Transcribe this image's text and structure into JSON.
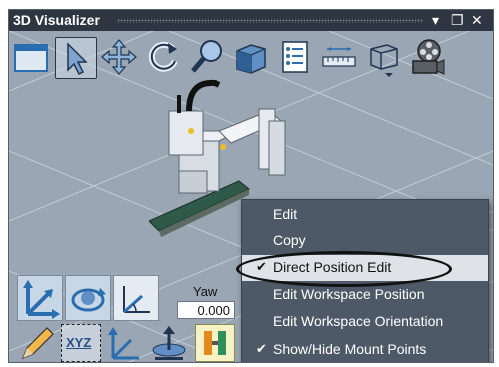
{
  "window": {
    "title": "3D Visualizer",
    "pin_glyph": "▾",
    "maximize_glyph": "❐",
    "close_glyph": "✕"
  },
  "toolbar": {
    "tools": [
      {
        "name": "view-window-icon"
      },
      {
        "name": "select-arrow-icon"
      },
      {
        "name": "pan-move-icon"
      },
      {
        "name": "rotate-view-icon"
      },
      {
        "name": "zoom-magnifier-icon"
      },
      {
        "name": "cube-view-icon"
      },
      {
        "name": "list-properties-icon"
      },
      {
        "name": "measure-ruler-icon"
      },
      {
        "name": "wireframe-box-icon"
      },
      {
        "name": "film-reel-icon"
      }
    ]
  },
  "context_menu": {
    "items": [
      {
        "label": "Edit",
        "checked": false,
        "highlighted": false
      },
      {
        "label": "Copy",
        "checked": false,
        "highlighted": false
      },
      {
        "label": "Direct Position Edit",
        "checked": true,
        "highlighted": true
      },
      {
        "label": "Edit Workspace Position",
        "checked": false,
        "highlighted": false
      },
      {
        "label": "Edit Workspace Orientation",
        "checked": false,
        "highlighted": false
      },
      {
        "label": "Show/Hide Mount Points",
        "checked": true,
        "highlighted": false
      }
    ],
    "check_glyph": "✔"
  },
  "orientation_panel": {
    "yaw_label": "Yaw",
    "yaw_value": "0.000"
  },
  "bottom_tools": {
    "xyz_label": "XYZ"
  }
}
